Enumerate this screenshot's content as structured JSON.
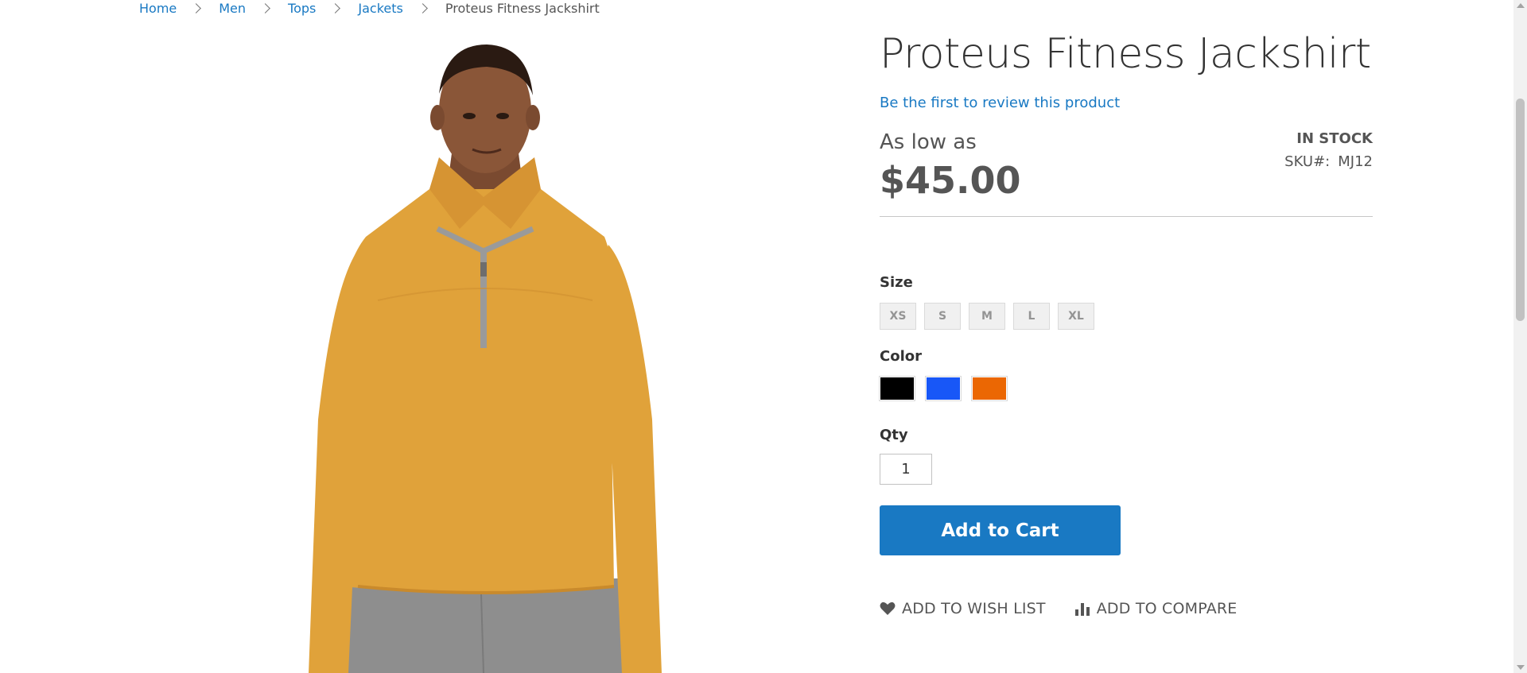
{
  "breadcrumbs": {
    "home": "Home",
    "men": "Men",
    "tops": "Tops",
    "jackets": "Jackets",
    "current": "Proteus Fitness Jackshirt"
  },
  "product": {
    "title": "Proteus Fitness Jackshirt",
    "review_link": "Be the first to review this product",
    "price_prefix": "As low as",
    "price": "$45.00",
    "stock_status": "IN STOCK",
    "sku_label": "SKU#:",
    "sku_value": "MJ12",
    "image_icon": "product-photo"
  },
  "options": {
    "size_label": "Size",
    "sizes": [
      "XS",
      "S",
      "M",
      "L",
      "XL"
    ],
    "color_label": "Color",
    "colors": [
      "#000000",
      "#1857f7",
      "#eb6703"
    ],
    "qty_label": "Qty",
    "qty_value": "1"
  },
  "actions": {
    "add_to_cart": "Add to Cart",
    "wish_list": "Add to Wish List",
    "compare": "Add to Compare"
  },
  "theme": {
    "link_color": "#1979c3",
    "primary_button": "#1979c3",
    "shirt_color": "#e0a23a"
  }
}
